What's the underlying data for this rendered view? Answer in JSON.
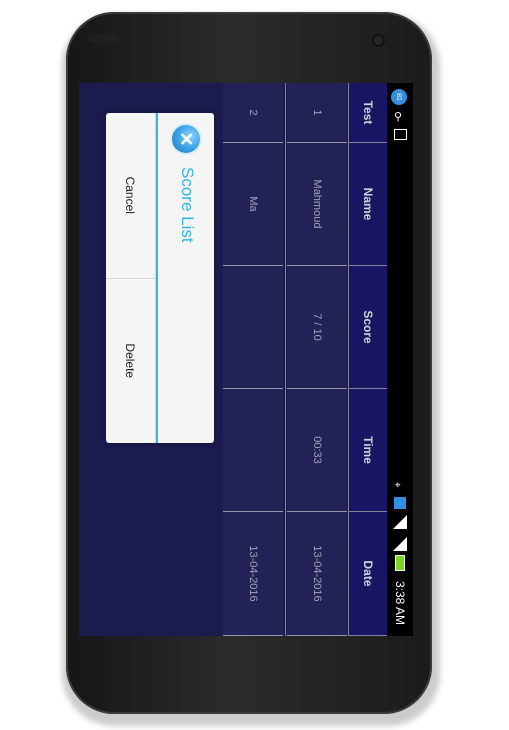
{
  "table": {
    "headers": [
      "Test",
      "Name",
      "Score",
      "Time",
      "Date"
    ],
    "rows": [
      [
        "1",
        "Mahmoud",
        "7 / 10",
        "00:33",
        "13-04-2016"
      ],
      [
        "2",
        "Ma",
        "",
        "",
        "13-04-2016"
      ]
    ]
  },
  "dialog": {
    "title": "Score List",
    "icon": "close-icon",
    "delete_label": "Delete",
    "cancel_label": "Cancel"
  },
  "status_bar": {
    "time": "3:38 AM",
    "notification_badge": "81",
    "colors": {
      "background": "#000000",
      "battery": "#7dd321",
      "notification": "#2f8fe0"
    }
  },
  "colors": {
    "app_background": "#232160",
    "header_background": "#1e1c78",
    "dialog_accent": "#33b5e5"
  }
}
